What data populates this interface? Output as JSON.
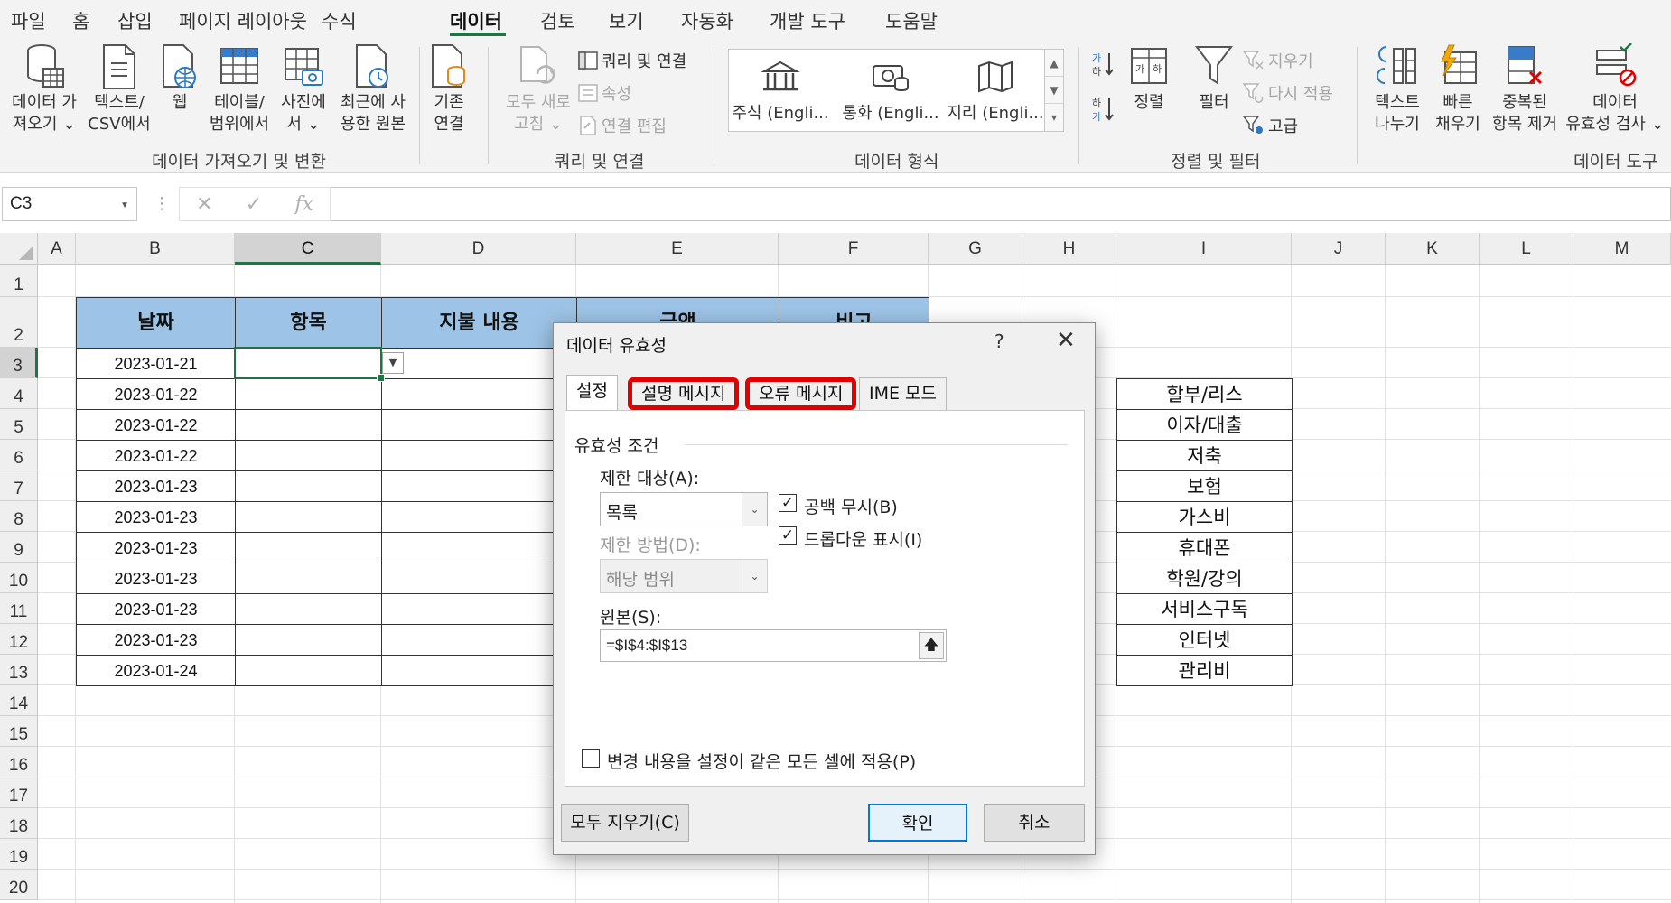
{
  "ribbon_tabs": [
    "파일",
    "홈",
    "삽입",
    "페이지 레이아웃",
    "수식",
    "데이터",
    "검토",
    "보기",
    "자동화",
    "개발 도구",
    "도움말"
  ],
  "active_tab": "데이터",
  "ribbon": {
    "get_data": {
      "l1": "데이터 가",
      "l2": "져오기 ⌄"
    },
    "text_csv": {
      "l1": "텍스트/",
      "l2": "CSV에서"
    },
    "web": {
      "l1": "웹"
    },
    "table_range": {
      "l1": "테이블/",
      "l2": "범위에서"
    },
    "from_picture": {
      "l1": "사진에",
      "l2": "서 ⌄"
    },
    "recent": {
      "l1": "최근에 사",
      "l2": "용한 원본"
    },
    "existing": {
      "l1": "기존",
      "l2": "연결"
    },
    "group1_label": "데이터 가져오기 및 변환",
    "refresh_all": {
      "l1": "모두 새로",
      "l2": "고침 ⌄"
    },
    "queries_connections": "쿼리 및 연결",
    "properties": "속성",
    "edit_links": "연결 편집",
    "group2_label": "쿼리 및 연결",
    "stocks": "주식 (Engli...",
    "currencies": "통화 (Engli...",
    "geography": "지리 (Engli...",
    "group3_label": "데이터 형식",
    "sort": "정렬",
    "filter": "필터",
    "clear": "지우기",
    "reapply": "다시 적용",
    "advanced": "고급",
    "group4_label": "정렬 및 필터",
    "text_to_columns": {
      "l1": "텍스트",
      "l2": "나누기"
    },
    "flash_fill": {
      "l1": "빠른",
      "l2": "채우기"
    },
    "remove_duplicates": {
      "l1": "중복된",
      "l2": "항목 제거"
    },
    "data_validation": {
      "l1": "데이터",
      "l2": "유효성 검사 ⌄"
    },
    "group5_label": "데이터 도구"
  },
  "formula_bar": {
    "name_box": "C3",
    "fx": "fx",
    "value": ""
  },
  "columns": [
    "A",
    "B",
    "C",
    "D",
    "E",
    "F",
    "G",
    "H",
    "I",
    "J",
    "K",
    "L",
    "M"
  ],
  "rows": [
    "1",
    "2",
    "3",
    "4",
    "5",
    "6",
    "7",
    "8",
    "9",
    "10",
    "11",
    "12",
    "13",
    "14",
    "15",
    "16",
    "17",
    "18",
    "19",
    "20"
  ],
  "table": {
    "headers": [
      "날짜",
      "항목",
      "지불 내용",
      "금액",
      "비고"
    ],
    "dates": [
      "2023-01-21",
      "2023-01-22",
      "2023-01-22",
      "2023-01-22",
      "2023-01-23",
      "2023-01-23",
      "2023-01-23",
      "2023-01-23",
      "2023-01-23",
      "2023-01-23",
      "2023-01-24"
    ]
  },
  "category_list": [
    "할부/리스",
    "이자/대출",
    "저축",
    "보험",
    "가스비",
    "휴대폰",
    "학원/강의",
    "서비스구독",
    "인터넷",
    "관리비"
  ],
  "dialog": {
    "title": "데이터 유효성",
    "help": "?",
    "close": "✕",
    "tabs": [
      "설정",
      "설명 메시지",
      "오류 메시지",
      "IME 모드"
    ],
    "section": "유효성 조건",
    "allow_label": "제한 대상(A):",
    "allow_value": "목록",
    "ignore_blank": "공백 무시(B)",
    "dropdown": "드롭다운 표시(I)",
    "data_label": "제한 방법(D):",
    "data_value": "해당 범위",
    "source_label": "원본(S):",
    "source_value": "=$I$4:$I$13",
    "apply_all": "변경 내용을 설정이 같은 모든 셀에 적용(P)",
    "clear_all": "모두 지우기(C)",
    "ok": "확인",
    "cancel": "취소"
  },
  "colors": {
    "accent": "#217346",
    "header_fill": "#9dc3e6",
    "highlight": "#e00000"
  }
}
